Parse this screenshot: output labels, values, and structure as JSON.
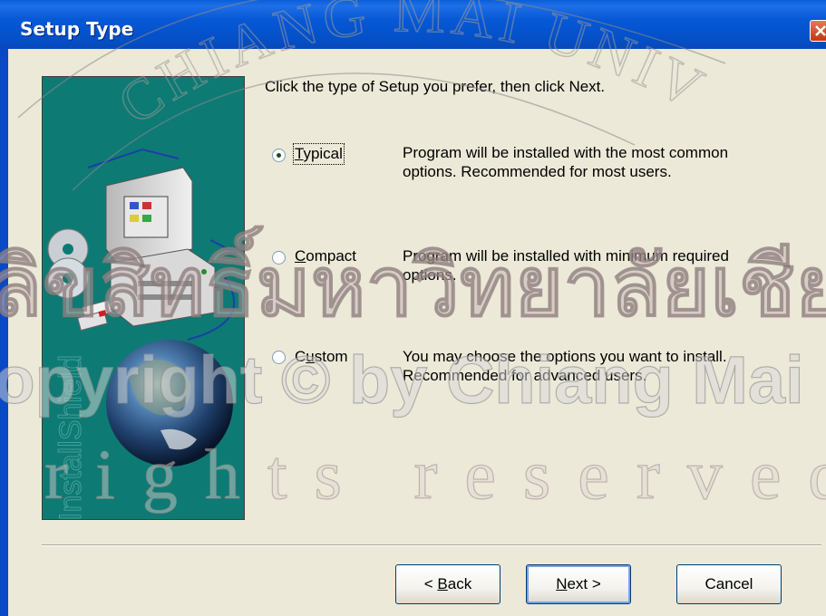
{
  "window": {
    "title": "Setup Type"
  },
  "instruction": "Click the type of Setup you prefer, then click Next.",
  "options": [
    {
      "key": "T",
      "rest": "ypical",
      "label": "Typical",
      "checked": true,
      "desc_line1": "Program will be installed with the most common",
      "desc_line2": "options.  Recommended for most users."
    },
    {
      "key": "C",
      "rest": "ompact",
      "label": "Compact",
      "checked": false,
      "desc_line1": "Program will be installed with minimum required",
      "desc_line2": "options."
    },
    {
      "key": "u",
      "pre": "C",
      "rest": "stom",
      "label": "Custom",
      "checked": false,
      "desc_line1": "You may choose the options you want to install.",
      "desc_line2": "Recommended for advanced users."
    }
  ],
  "buttons": {
    "back": {
      "prefix": "< ",
      "key": "B",
      "rest": "ack"
    },
    "next": {
      "key": "N",
      "rest": "ext >"
    },
    "cancel": "Cancel"
  },
  "art": {
    "brand": "InstallShield"
  },
  "watermark": {
    "line1": "ลิขสิทธิ์มหาวิทยาลัยเชียงใหม่",
    "line2": "Copyright © by Chiang Mai University",
    "line3": "All rights reserved",
    "seal": "CHIANG MAI UNIVERSITY"
  },
  "colors": {
    "titlebar": "#0758d6",
    "face": "#ece9d8",
    "art_bg": "#0e7a74"
  }
}
